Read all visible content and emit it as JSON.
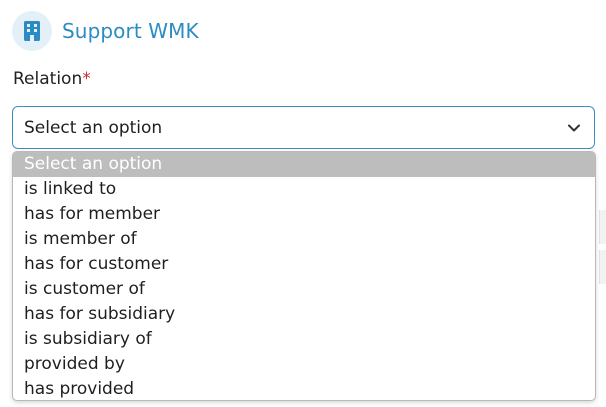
{
  "header": {
    "title": "Support WMK",
    "icon": "building-icon",
    "accent_color": "#2b8cc4"
  },
  "relation_field": {
    "label": "Relation",
    "required_marker": "*",
    "selected_value": "Select an option",
    "options": [
      "Select an option",
      "is linked to",
      "has for member",
      "is member of",
      "has for customer",
      "is customer of",
      "has for subsidiary",
      "is subsidiary of",
      "provided by",
      "has provided"
    ],
    "highlighted_option_index": 0
  }
}
